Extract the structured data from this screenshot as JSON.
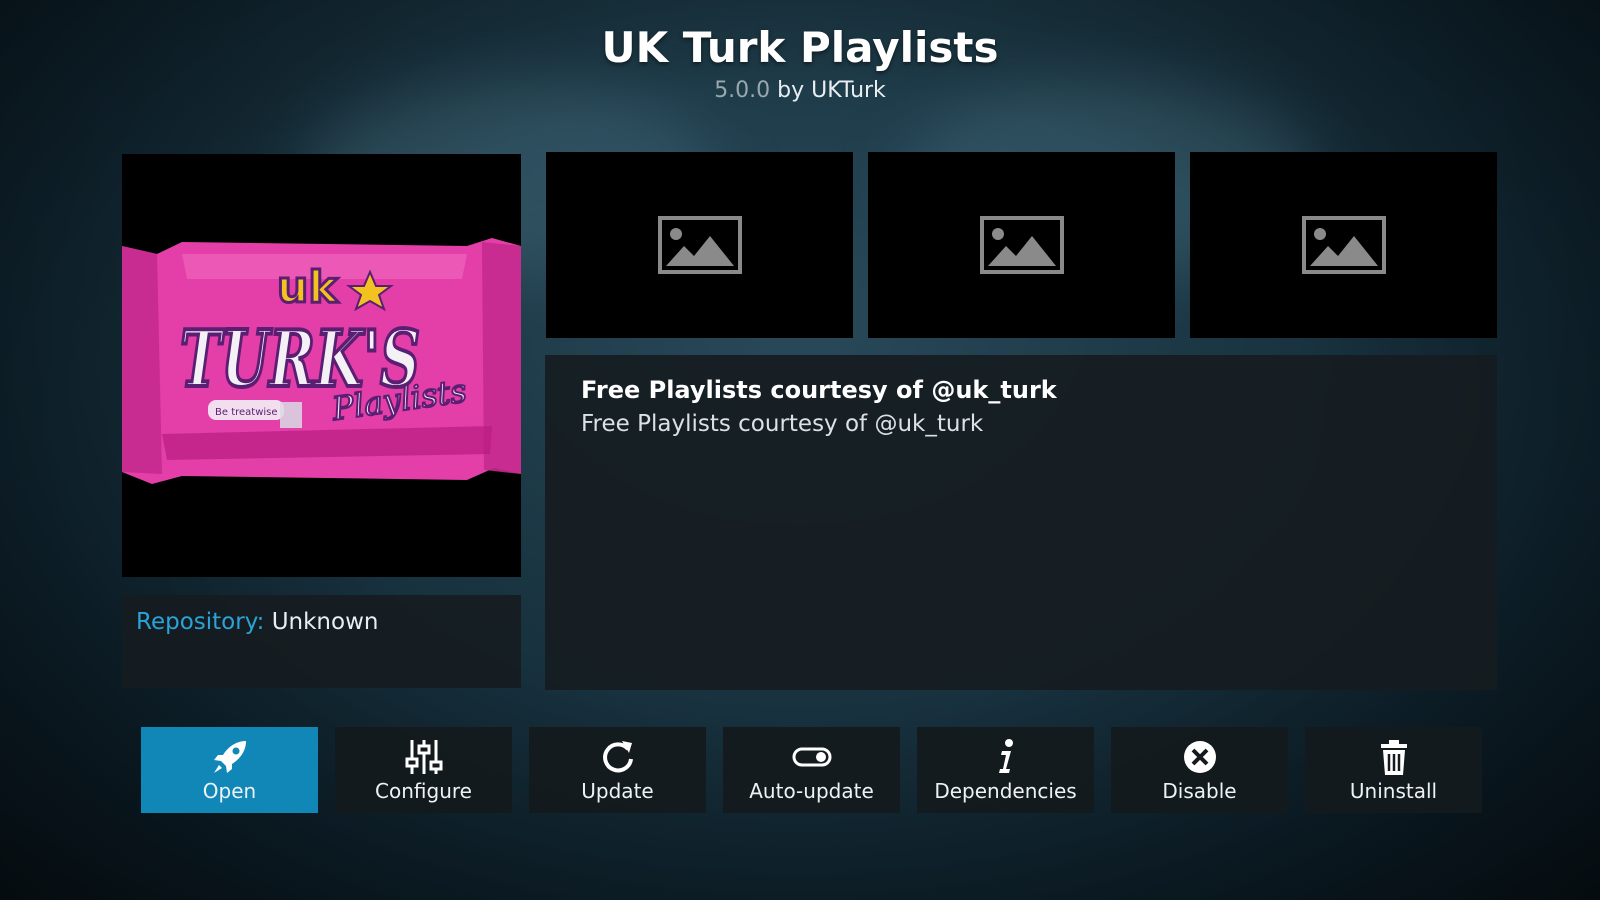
{
  "header": {
    "title": "UK Turk Playlists",
    "version": "5.0.0",
    "author": "by UKTurk"
  },
  "poster": {
    "brand_top": "uk",
    "brand_main": "TURK'S",
    "brand_sub": "Playlists",
    "pack_note": "Be treatwise",
    "colors": {
      "wrapper": "#e43ea8",
      "wrapper_dark": "#b81c80",
      "text_fill": "#f3f0f6",
      "text_outline": "#5a1e72",
      "accent_yellow": "#f2c221"
    }
  },
  "repository": {
    "label": "Repository:",
    "value": "Unknown"
  },
  "screenshots": [
    {
      "icon": "image-placeholder-icon"
    },
    {
      "icon": "image-placeholder-icon"
    },
    {
      "icon": "image-placeholder-icon"
    }
  ],
  "description": {
    "title": "Free Playlists courtesy of @uk_turk",
    "text": "Free Playlists courtesy of @uk_turk"
  },
  "buttons": [
    {
      "label": "Open",
      "icon": "rocket-icon",
      "active": true
    },
    {
      "label": "Configure",
      "icon": "sliders-icon",
      "active": false
    },
    {
      "label": "Update",
      "icon": "refresh-icon",
      "active": false
    },
    {
      "label": "Auto-update",
      "icon": "toggle-icon",
      "active": false
    },
    {
      "label": "Dependencies",
      "icon": "info-icon",
      "active": false
    },
    {
      "label": "Disable",
      "icon": "close-circle-icon",
      "active": false
    },
    {
      "label": "Uninstall",
      "icon": "trash-icon",
      "active": false
    }
  ],
  "colors": {
    "accent": "#1187b8",
    "repo_label": "#2aa3d6"
  }
}
